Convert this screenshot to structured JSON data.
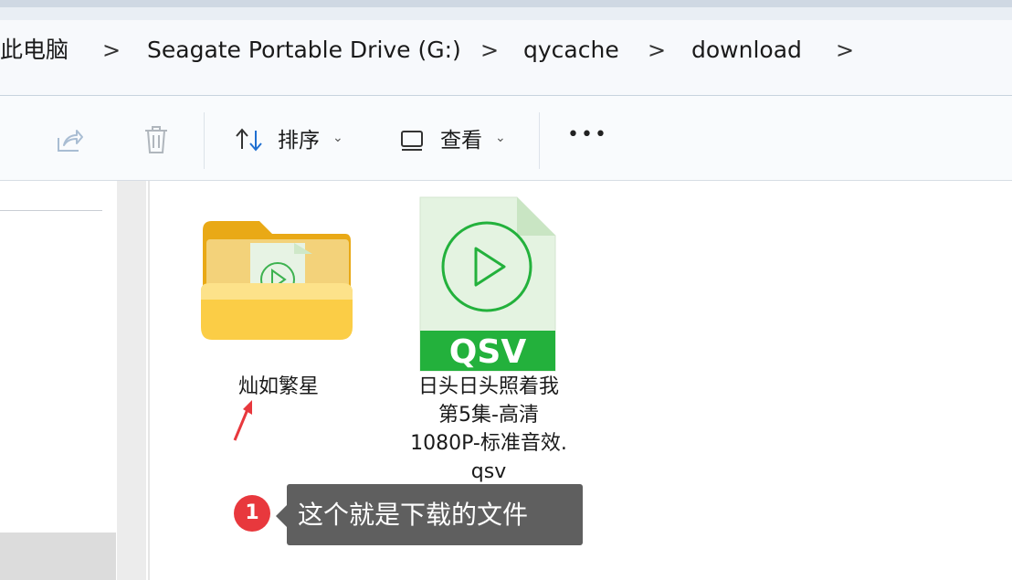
{
  "breadcrumb": {
    "items": [
      "此电脑",
      "Seagate Portable Drive (G:)",
      "qycache",
      "download"
    ],
    "separator": ">"
  },
  "toolbar": {
    "share_icon": "share-icon",
    "delete_icon": "trash-icon",
    "sort_label": "排序",
    "view_label": "查看",
    "more_label": "•••"
  },
  "files": [
    {
      "name": "灿如繁星",
      "type": "folder",
      "icon": "folder-with-video-icon"
    },
    {
      "name": "日头日头照着我第5集-高清1080P-标准音效.qsv",
      "type": "file",
      "icon": "qsv-video-file-icon",
      "badge": "QSV",
      "label_lines": [
        "日头日头照着我",
        "第5集-高清",
        "1080P-标准音效.",
        "qsv"
      ]
    }
  ],
  "annotation": {
    "number": "1",
    "text": "这个就是下载的文件"
  },
  "colors": {
    "folder": "#f7c24a",
    "qsv_green": "#23b13c",
    "arrow_red": "#e8383d",
    "callout_bg": "#5f5f5f"
  }
}
